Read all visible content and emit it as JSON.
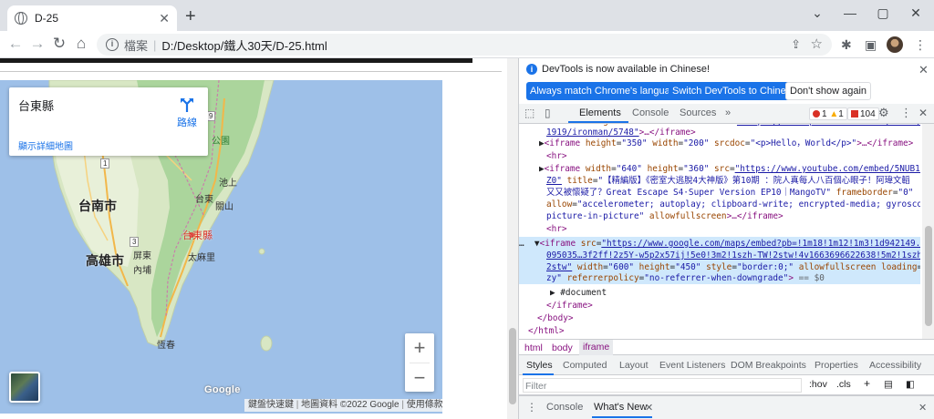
{
  "browser": {
    "tab_title": "D-25",
    "tab_close": "✕",
    "new_tab": "+",
    "window_controls": {
      "chevron": "⌄",
      "minimize": "—",
      "maximize": "▢",
      "close": "✕"
    },
    "nav": {
      "back": "←",
      "forward": "→",
      "reload": "↻",
      "home": "⌂"
    },
    "address": {
      "scheme_label": "檔案",
      "separator": "|",
      "url": "D:/Desktop/鐵人30天/D-25.html"
    },
    "icons": {
      "share": "⇪",
      "star": "☆",
      "extensions": "✱",
      "sidepanel": "▣",
      "menu": "⋮"
    }
  },
  "map": {
    "place_name": "台東縣",
    "directions_label": "路線",
    "bigger_map_link": "顯示詳細地圖",
    "zoom_in": "+",
    "zoom_out": "−",
    "google_logo": "Google",
    "attribution": [
      "鍵盤快速鍵",
      "地圖資料 ©2022 Google",
      "使用條款"
    ],
    "labels": {
      "tainan": "台南市",
      "kaohsiung": "高雄市",
      "taitung_county": "台東縣",
      "taitung_city": "台東",
      "taimali": "太麻里",
      "chishang": "池上",
      "guanshan": "關山",
      "pingtung": "屏東",
      "neipu": "內埔",
      "hengchun": "恆春",
      "park": "公園",
      "route_1": "1",
      "route_3": "3",
      "route_9": "9"
    }
  },
  "devtools": {
    "banner": {
      "message": "DevTools is now available in Chinese!",
      "btn_match": "Always match Chrome's language",
      "btn_switch": "Switch DevTools to Chinese",
      "btn_dismiss": "Don't show again",
      "close": "✕"
    },
    "tabs": [
      "Elements",
      "Console",
      "Sources",
      "»"
    ],
    "badges": {
      "errors": "1",
      "warnings": "1",
      "issues": "104"
    },
    "icons": {
      "settings": "⚙",
      "more": "⋮",
      "close": "✕",
      "inspect": "⬚",
      "device": "▯"
    },
    "breadcrumbs": [
      "html",
      "body",
      "iframe"
    ],
    "style_tabs": [
      "Styles",
      "Computed",
      "Layout",
      "Event Listeners",
      "DOM Breakpoints",
      "Properties",
      "Accessibility"
    ],
    "filter_placeholder": "Filter",
    "filter_buttons": {
      "hov": ":hov",
      "cls": ".cls",
      "add": "+"
    },
    "drawer_tabs": [
      "Console",
      "What's New"
    ],
    "drawer_close": "✕",
    "drawer_menu": "⋮"
  }
}
